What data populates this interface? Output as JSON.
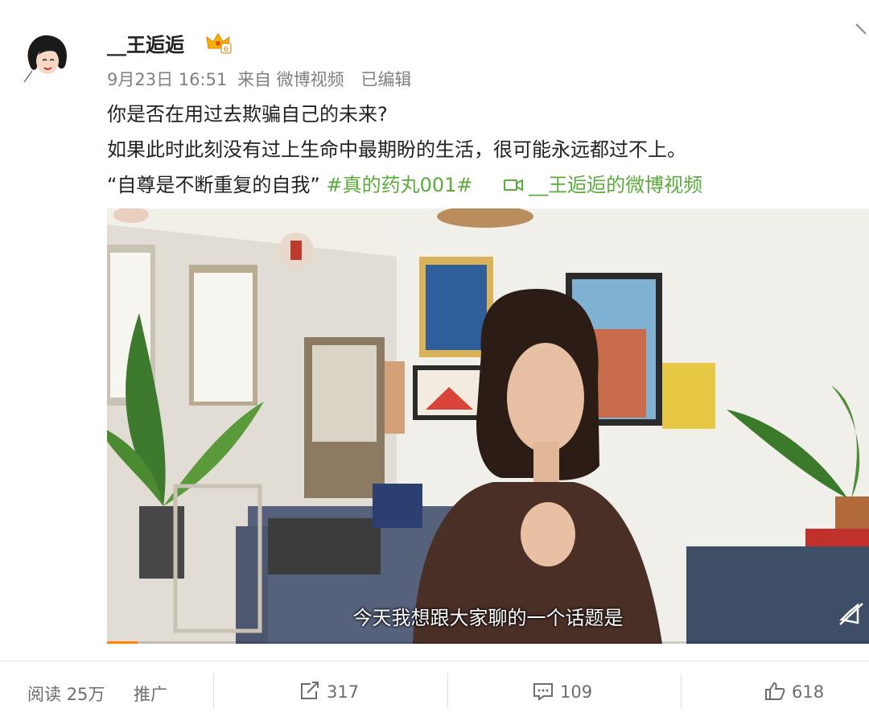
{
  "post": {
    "username": "__王逅逅",
    "meta": {
      "date": "9月23日 16:51",
      "source": "来自 微博视频",
      "edited": "已编辑"
    },
    "lines": [
      "你是否在用过去欺骗自己的未来?",
      "如果此时此刻没有过上生命中最期盼的生活，很可能永远都过不上。"
    ],
    "quote": "“自尊是不断重复的自我”",
    "hashtag": "#真的药丸001#",
    "video_link": "__王逅逅的微博视频"
  },
  "video": {
    "subtitle": "今天我想跟大家聊的一个话题是",
    "progress": 0.04
  },
  "footer": {
    "reads_label": "阅读",
    "reads_value": "25万",
    "promote": "推广",
    "reposts": "317",
    "comments": "109",
    "likes": "618"
  },
  "colors": {
    "accent_green": "#5bab3c",
    "progress": "#ff8200"
  }
}
